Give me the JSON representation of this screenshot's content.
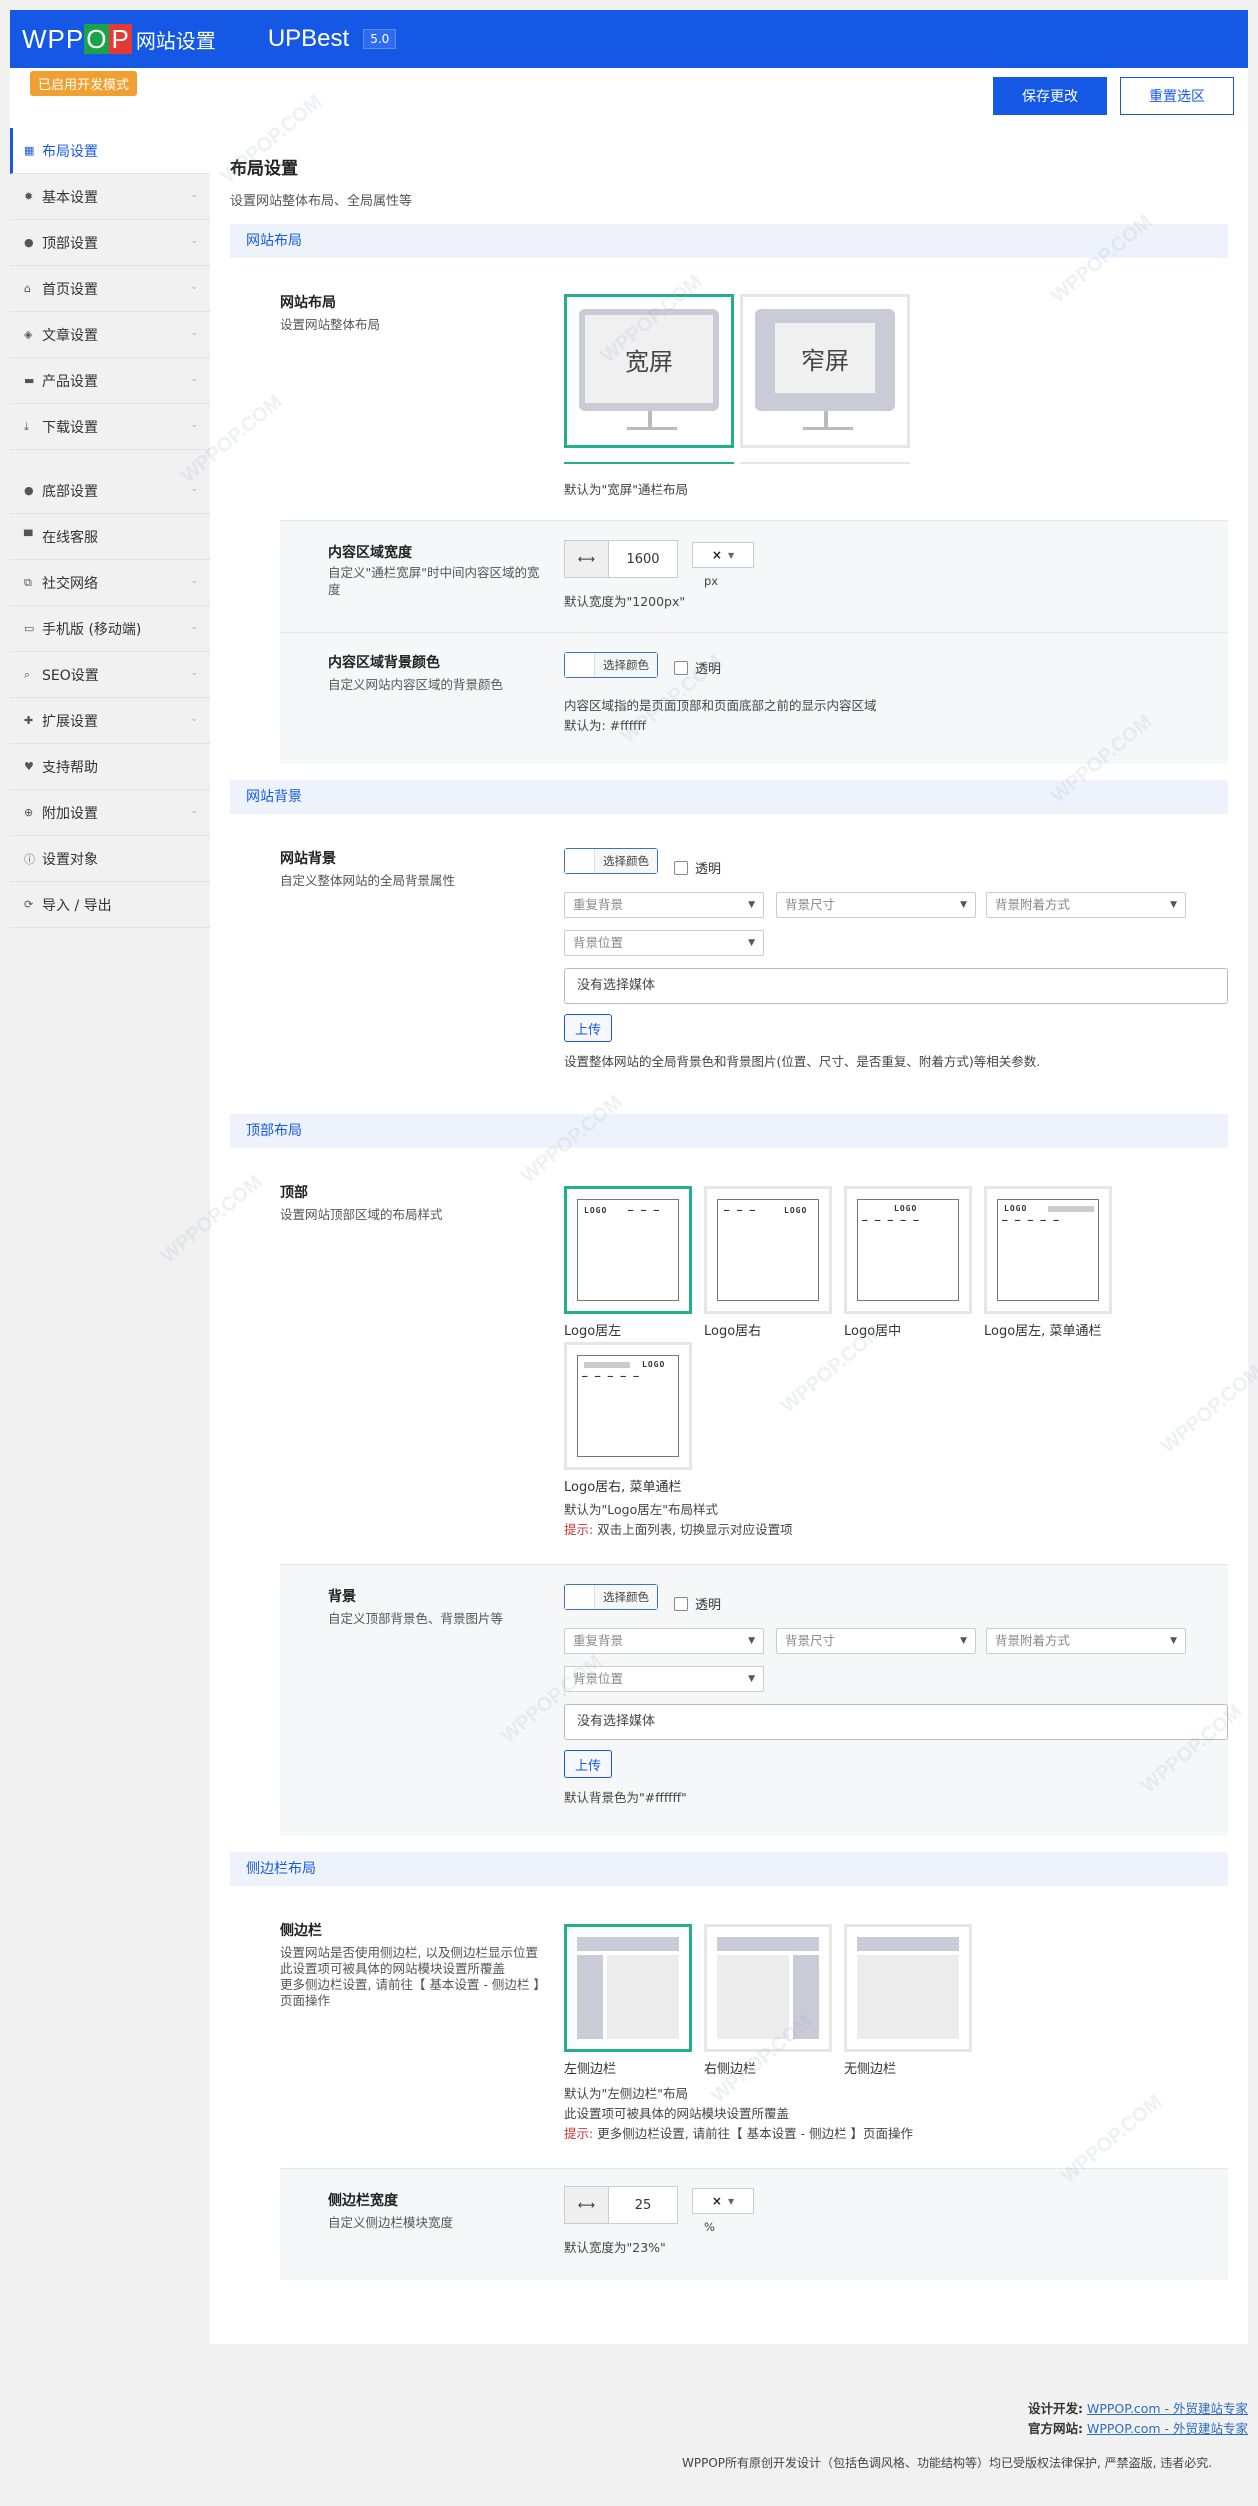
{
  "header": {
    "logo_w": "WP",
    "logo_p1": "P",
    "logo_o": "O",
    "logo_p2": "P",
    "logo_sub": "网站设置",
    "app_name": "UPBest",
    "version": "5.0",
    "dev_badge": "已启用开发模式",
    "save_label": "保存更改",
    "reset_label": "重置选区"
  },
  "sidebar": {
    "items": [
      {
        "label": "布局设置",
        "icon": "grid-icon"
      },
      {
        "label": "基本设置",
        "icon": "gear-icon"
      },
      {
        "label": "顶部设置",
        "icon": "circle-up-icon"
      },
      {
        "label": "首页设置",
        "icon": "home-icon"
      },
      {
        "label": "文章设置",
        "icon": "tag-icon"
      },
      {
        "label": "产品设置",
        "icon": "printer-icon"
      },
      {
        "label": "下载设置",
        "icon": "download-icon"
      },
      {
        "label": "底部设置",
        "icon": "circle-down-icon"
      },
      {
        "label": "在线客服",
        "icon": "chat-icon"
      },
      {
        "label": "社交网络",
        "icon": "share-icon"
      },
      {
        "label": "手机版 (移动端)",
        "icon": "laptop-icon"
      },
      {
        "label": "SEO设置",
        "icon": "search-icon"
      },
      {
        "label": "扩展设置",
        "icon": "puzzle-icon"
      },
      {
        "label": "支持帮助",
        "icon": "heart-icon"
      },
      {
        "label": "附加设置",
        "icon": "plus-circle-icon"
      },
      {
        "label": "设置对象",
        "icon": "info-icon"
      },
      {
        "label": "导入 / 导出",
        "icon": "refresh-icon"
      }
    ]
  },
  "main": {
    "title": "布局设置",
    "desc": "设置网站整体布局、全局属性等",
    "site_layout": {
      "group": "网站布局",
      "label": "网站布局",
      "desc": "设置网站整体布局",
      "opt_wide": "宽屏",
      "opt_narrow": "窄屏",
      "default_note": "默认为\"宽屏\"通栏布局",
      "width_label": "内容区域宽度",
      "width_desc": "自定义\"通栏宽屏\"时中间内容区域的宽度",
      "width_value": "1600",
      "width_unit": "px",
      "width_default": "默认宽度为\"1200px\"",
      "bg_label": "内容区域背景颜色",
      "bg_desc": "自定义网站内容区域的背景颜色",
      "color_btn": "选择颜色",
      "transparent": "透明",
      "bg_note1": "内容区域指的是页面顶部和页面底部之前的显示内容区域",
      "bg_note2": "默认为: #ffffff"
    },
    "site_bg": {
      "group": "网站背景",
      "label": "网站背景",
      "desc": "自定义整体网站的全局背景属性",
      "color_btn": "选择颜色",
      "transparent": "透明",
      "repeat": "重复背景",
      "size": "背景尺寸",
      "attach": "背景附着方式",
      "position": "背景位置",
      "media": "没有选择媒体",
      "upload": "上传",
      "note": "设置整体网站的全局背景色和背景图片(位置、尺寸、是否重复、附着方式)等相关参数."
    },
    "top_layout": {
      "group": "顶部布局",
      "label": "顶部",
      "desc": "设置网站顶部区域的布局样式",
      "logo": "LOGO",
      "dash3": "— — —",
      "dash5": "— — — — —",
      "cap1": "Logo居左",
      "cap2": "Logo居右",
      "cap3": "Logo居中",
      "cap4": "Logo居左, 菜单通栏",
      "cap5": "Logo居右, 菜单通栏",
      "default_note": "默认为\"Logo居左\"布局样式",
      "hint_prefix": "提示:",
      "hint": " 双击上面列表, 切换显示对应设置项",
      "bg_label": "背景",
      "bg_desc": "自定义顶部背景色、背景图片等",
      "color_btn": "选择颜色",
      "transparent": "透明",
      "repeat": "重复背景",
      "size": "背景尺寸",
      "attach": "背景附着方式",
      "position": "背景位置",
      "media": "没有选择媒体",
      "upload": "上传",
      "bg_default": "默认背景色为\"#ffffff\""
    },
    "sidebar_layout": {
      "group": "侧边栏布局",
      "label": "侧边栏",
      "desc1": "设置网站是否使用侧边栏, 以及侧边栏显示位置",
      "desc2": "此设置项可被具体的网站模块设置所覆盖",
      "desc3": "更多侧边栏设置, 请前往【 基本设置 - 侧边栏 】",
      "desc4": "页面操作",
      "cap1": "左侧边栏",
      "cap2": "右侧边栏",
      "cap3": "无侧边栏",
      "note1": "默认为\"左侧边栏\"布局",
      "note2": "此设置项可被具体的网站模块设置所覆盖",
      "hint_prefix": "提示:",
      "hint": " 更多侧边栏设置, 请前往【 基本设置 - 侧边栏 】页面操作",
      "width_label": "侧边栏宽度",
      "width_desc": "自定义侧边栏模块宽度",
      "width_value": "25",
      "width_unit": "%",
      "width_default": "默认宽度为\"23%\""
    }
  },
  "footer": {
    "dev_label": "设计开发:",
    "dev_link": "WPPOP.com - 外贸建站专家",
    "site_label": "官方网站:",
    "site_link": "WPPOP.com - 外贸建站专家",
    "copyright": "WPPOP所有原创开发设计（包括色调风格、功能结构等）均已受版权法律保护, 严禁盗版, 违者必究."
  },
  "watermark": "WPPOP.COM"
}
